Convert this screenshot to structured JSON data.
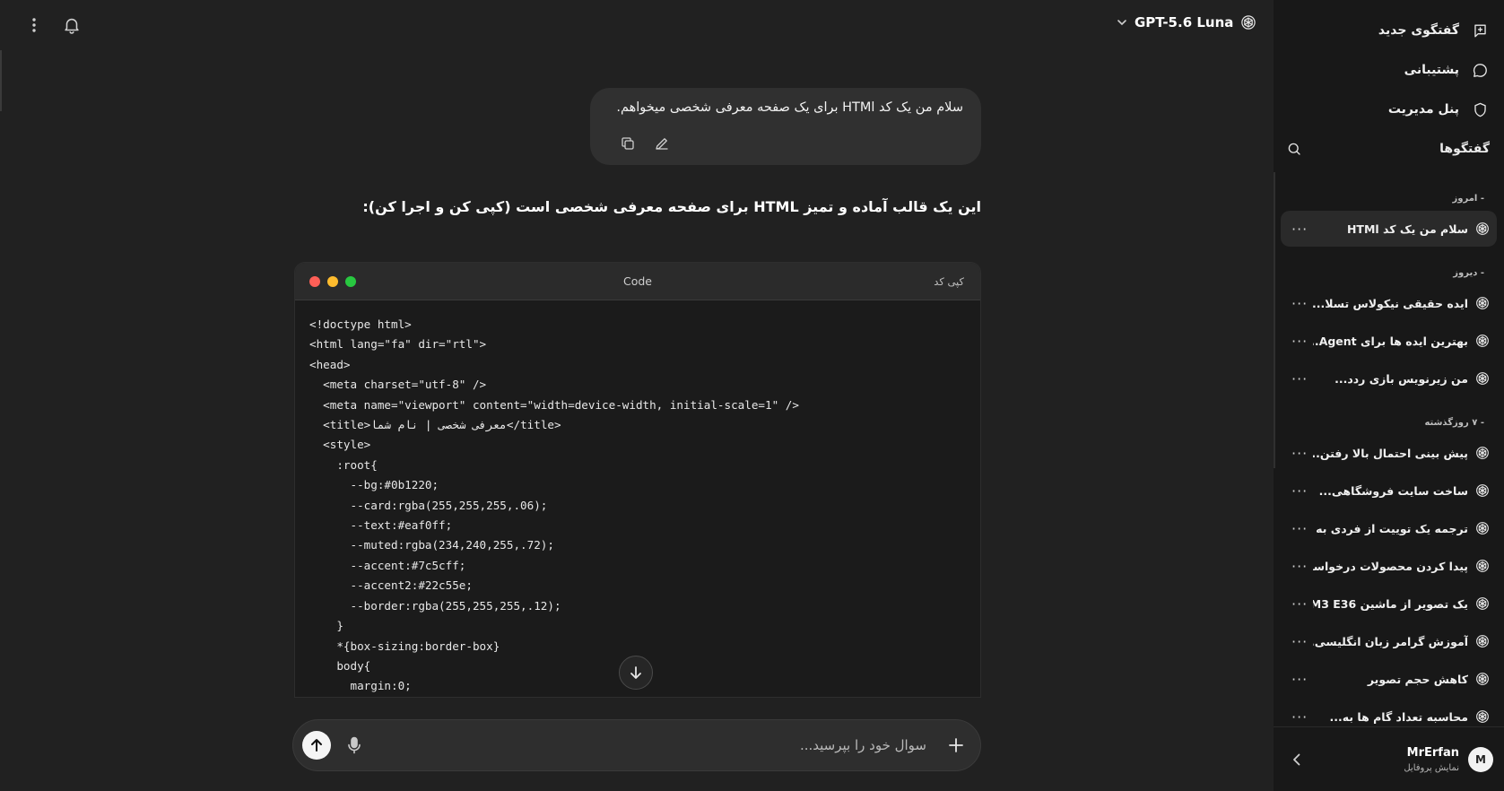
{
  "header": {
    "model_name": "GPT-5.6 Luna",
    "icons": {
      "menu": "more-vertical-icon",
      "notifications": "bell-icon",
      "model_dropdown": "chevron-down-icon",
      "model": "openai-logo-icon"
    }
  },
  "sidebar": {
    "links": [
      {
        "label": "گفتگوی جدید",
        "icon": "new-chat-icon"
      },
      {
        "label": "پشتیبانی",
        "icon": "chat-bubble-icon"
      },
      {
        "label": "پنل مدیریت",
        "icon": "shield-icon"
      }
    ],
    "conversations_title": "گفتگوها",
    "groups": [
      {
        "label": "- امروز",
        "items": [
          {
            "title": "سلام من یک کد HTMl",
            "more": "···",
            "active": true
          }
        ]
      },
      {
        "label": "- دیروز",
        "items": [
          {
            "title": "ایده حقیقی نیکولاس تسلا...",
            "more": "···"
          },
          {
            "title": "بهترین ایده ها برای Agent...",
            "more": "···"
          },
          {
            "title": "من زیرنویس بازی ردد...",
            "more": "···"
          }
        ]
      },
      {
        "label": "- ۷ روزگذشته",
        "items": [
          {
            "title": "پیش بینی احتمال بالا رفتن...",
            "more": "···"
          },
          {
            "title": "ساخت سایت فروشگاهی...",
            "more": "···"
          },
          {
            "title": "ترجمه یک توییت از فردی به ا...",
            "more": "···"
          },
          {
            "title": "پیدا کردن محصولات درخواست...",
            "more": "···"
          },
          {
            "title": "یک تصویر از ماشین M3 E36 ...",
            "more": "···"
          },
          {
            "title": "آموزش گرامر زبان انگلیسی...",
            "more": "···"
          },
          {
            "title": "کاهش حجم تصویر",
            "more": "···"
          },
          {
            "title": "محاسبه تعداد گام ها به...",
            "more": "···"
          }
        ]
      }
    ],
    "profile": {
      "avatar_letter": "M",
      "name": "MrErfan",
      "subtitle": "نمایش پروفایل"
    }
  },
  "chat": {
    "user_message": "سلام من یک کد HTMl برای یک صفحه معرفی شخصی میخواهم.",
    "assistant_intro": "این یک قالب آماده و تمیز HTML برای صفحه معرفی شخصی است (کپی کن و اجرا کن):",
    "code_block": {
      "language": "Code",
      "copy_label": "کپی کد",
      "lines": [
        "<!doctype html>",
        "<html lang=\"fa\" dir=\"rtl\">",
        "<head>",
        "  <meta charset=\"utf-8\" />",
        "  <meta name=\"viewport\" content=\"width=device-width, initial-scale=1\" />",
        "  <title>معرفی شخصی | نام شما</title>",
        "  <style>",
        "    :root{",
        "      --bg:#0b1220;",
        "      --card:rgba(255,255,255,.06);",
        "      --text:#eaf0ff;",
        "      --muted:rgba(234,240,255,.72);",
        "      --accent:#7c5cff;",
        "      --accent2:#22c55e;",
        "      --border:rgba(255,255,255,.12);",
        "    }",
        "    *{box-sizing:border-box}",
        "    body{",
        "      margin:0;"
      ],
      "window_dots": [
        "#ff5f57",
        "#febc2e",
        "#28c840"
      ]
    }
  },
  "composer": {
    "placeholder": "سوال خود را بپرسید..."
  },
  "colors": {
    "background": "#212121",
    "sidebar": "#181818",
    "bubble": "#303030"
  }
}
